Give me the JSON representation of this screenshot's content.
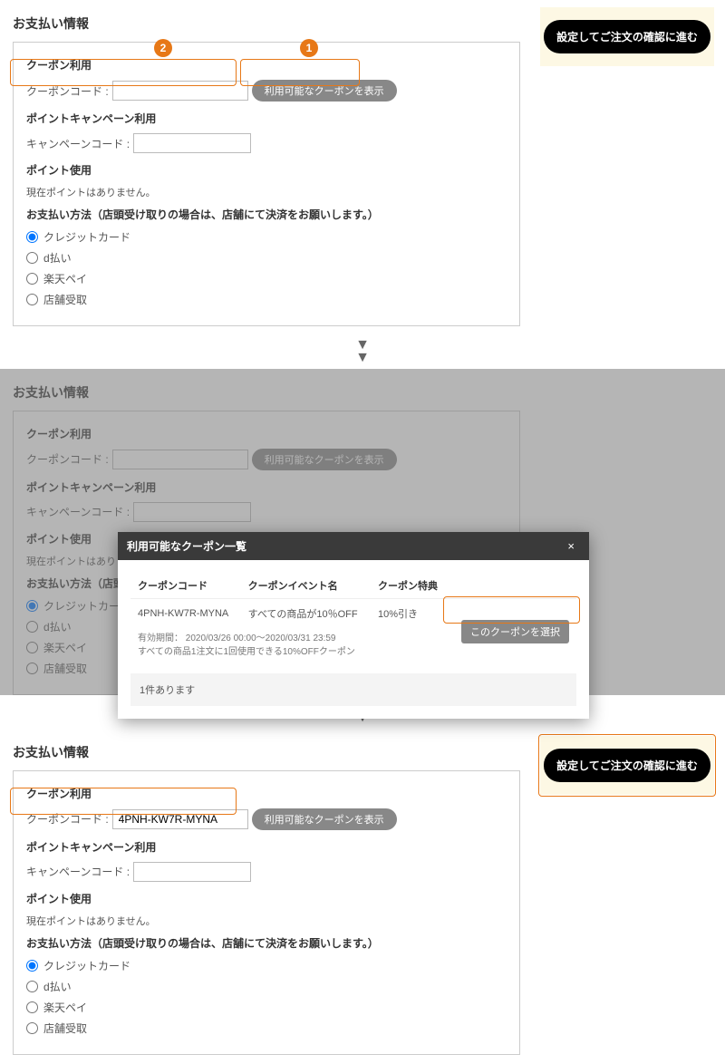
{
  "common": {
    "section_title": "お支払い情報",
    "coupon_heading": "クーポン利用",
    "coupon_label": "クーポンコード :",
    "show_coupons_btn": "利用可能なクーポンを表示",
    "campaign_heading": "ポイントキャンペーン利用",
    "campaign_label": "キャンペーンコード :",
    "points_heading": "ポイント使用",
    "points_note": "現在ポイントはありません。",
    "payment_heading_full": "お支払い方法（店頭受け取りの場合は、店舗にて決済をお願いします。）",
    "payment_heading_short": "お支払い方法（店頭受け",
    "payment_options": [
      "クレジットカード",
      "d払い",
      "楽天ペイ",
      "店舗受取"
    ],
    "cta_label": "設定してご注文の確認に進む"
  },
  "callouts": {
    "one": "1",
    "two": "2"
  },
  "panel1": {
    "coupon_value": ""
  },
  "panel3": {
    "coupon_value": "4PNH-KW7R-MYNA"
  },
  "modal": {
    "title": "利用可能なクーポン一覧",
    "columns": [
      "クーポンコード",
      "クーポンイベント名",
      "クーポン特典"
    ],
    "row": {
      "code": "4PNH-KW7R-MYNA",
      "event": "すべての商品が10％OFF",
      "benefit": "10%引き",
      "select_label": "このクーポンを選択",
      "validity": "有効期間： 2020/03/26 00:00～2020/03/31 23:59",
      "detail": "すべての商品1注文に1回使用できる10%OFFクーポン"
    },
    "count": "1件あります"
  }
}
